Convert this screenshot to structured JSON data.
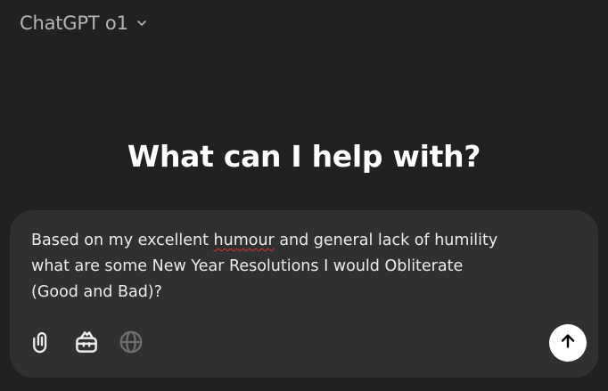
{
  "header": {
    "model_name": "ChatGPT o1",
    "dropdown_icon": "chevron-down-icon"
  },
  "main": {
    "headline": "What can I help with?"
  },
  "composer": {
    "text_part1": "Based on my excellent ",
    "text_misspelled": "humour",
    "text_part2": " and general lack of humility\nwhat are some New Year Resolutions I would Obliterate\n(Good and Bad)?",
    "tools": [
      {
        "icon": "paperclip-icon",
        "enabled": true
      },
      {
        "icon": "toolbox-icon",
        "enabled": true
      },
      {
        "icon": "globe-icon",
        "enabled": false
      }
    ],
    "send_icon": "arrow-up-icon",
    "colors": {
      "background": "#303030",
      "spellcheck_underline": "#e03131",
      "send_button": "#ffffff"
    }
  },
  "colors": {
    "page_background": "#212121",
    "headline": "#ffffff",
    "model_name": "#b4b4b4"
  }
}
